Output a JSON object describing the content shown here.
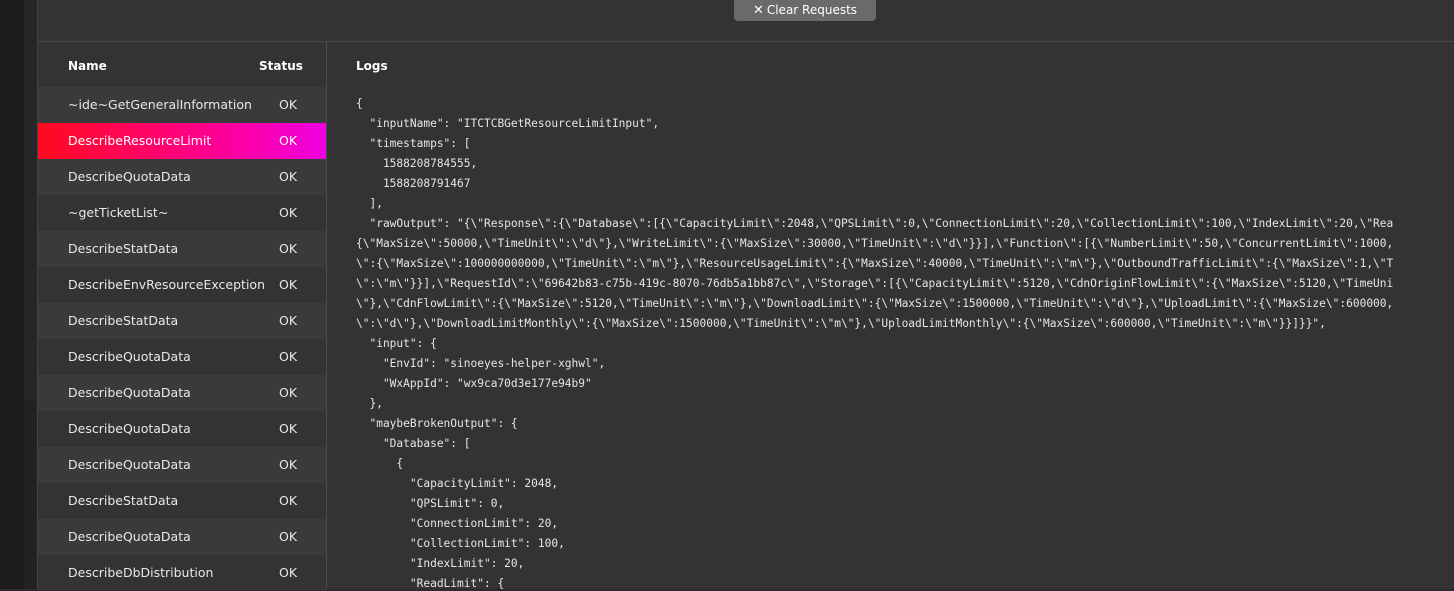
{
  "toolbar": {
    "clear_label": "Clear Requests",
    "clear_icon": "close-icon"
  },
  "list": {
    "header_name": "Name",
    "header_status": "Status",
    "rows": [
      {
        "name": "~ide~GetGeneralInformation",
        "status": "OK"
      },
      {
        "name": "DescribeResourceLimit",
        "status": "OK"
      },
      {
        "name": "DescribeQuotaData",
        "status": "OK"
      },
      {
        "name": "~getTicketList~",
        "status": "OK"
      },
      {
        "name": "DescribeStatData",
        "status": "OK"
      },
      {
        "name": "DescribeEnvResourceException",
        "status": "OK"
      },
      {
        "name": "DescribeStatData",
        "status": "OK"
      },
      {
        "name": "DescribeQuotaData",
        "status": "OK"
      },
      {
        "name": "DescribeQuotaData",
        "status": "OK"
      },
      {
        "name": "DescribeQuotaData",
        "status": "OK"
      },
      {
        "name": "DescribeQuotaData",
        "status": "OK"
      },
      {
        "name": "DescribeStatData",
        "status": "OK"
      },
      {
        "name": "DescribeQuotaData",
        "status": "OK"
      },
      {
        "name": "DescribeDbDistribution",
        "status": "OK"
      }
    ],
    "selected_index": 1
  },
  "logs": {
    "title": "Logs",
    "lines": [
      "{",
      "  \"inputName\": \"ITCTCBGetResourceLimitInput\",",
      "  \"timestamps\": [",
      "    1588208784555,",
      "    1588208791467",
      "  ],",
      "  \"rawOutput\": \"{\\\"Response\\\":{\\\"Database\\\":[{\\\"CapacityLimit\\\":2048,\\\"QPSLimit\\\":0,\\\"ConnectionLimit\\\":20,\\\"CollectionLimit\\\":100,\\\"IndexLimit\\\":20,\\\"Rea",
      "{\\\"MaxSize\\\":50000,\\\"TimeUnit\\\":\\\"d\\\"},\\\"WriteLimit\\\":{\\\"MaxSize\\\":30000,\\\"TimeUnit\\\":\\\"d\\\"}}],\\\"Function\\\":[{\\\"NumberLimit\\\":50,\\\"ConcurrentLimit\\\":1000,",
      "\\\":{\\\"MaxSize\\\":100000000000,\\\"TimeUnit\\\":\\\"m\\\"},\\\"ResourceUsageLimit\\\":{\\\"MaxSize\\\":40000,\\\"TimeUnit\\\":\\\"m\\\"},\\\"OutboundTrafficLimit\\\":{\\\"MaxSize\\\":1,\\\"T",
      "\\\":\\\"m\\\"}}],\\\"RequestId\\\":\\\"69642b83-c75b-419c-8070-76db5a1bb87c\\\",\\\"Storage\\\":[{\\\"CapacityLimit\\\":5120,\\\"CdnOriginFlowLimit\\\":{\\\"MaxSize\\\":5120,\\\"TimeUni",
      "\\\"},\\\"CdnFlowLimit\\\":{\\\"MaxSize\\\":5120,\\\"TimeUnit\\\":\\\"m\\\"},\\\"DownloadLimit\\\":{\\\"MaxSize\\\":1500000,\\\"TimeUnit\\\":\\\"d\\\"},\\\"UploadLimit\\\":{\\\"MaxSize\\\":600000,",
      "\\\":\\\"d\\\"},\\\"DownloadLimitMonthly\\\":{\\\"MaxSize\\\":1500000,\\\"TimeUnit\\\":\\\"m\\\"},\\\"UploadLimitMonthly\\\":{\\\"MaxSize\\\":600000,\\\"TimeUnit\\\":\\\"m\\\"}}]}}\",",
      "  \"input\": {",
      "    \"EnvId\": \"sinoeyes-helper-xghwl\",",
      "    \"WxAppId\": \"wx9ca70d3e177e94b9\"",
      "  },",
      "  \"maybeBrokenOutput\": {",
      "    \"Database\": [",
      "      {",
      "        \"CapacityLimit\": 2048,",
      "        \"QPSLimit\": 0,",
      "        \"ConnectionLimit\": 20,",
      "        \"CollectionLimit\": 100,",
      "        \"IndexLimit\": 20,",
      "        \"ReadLimit\": {"
    ]
  }
}
